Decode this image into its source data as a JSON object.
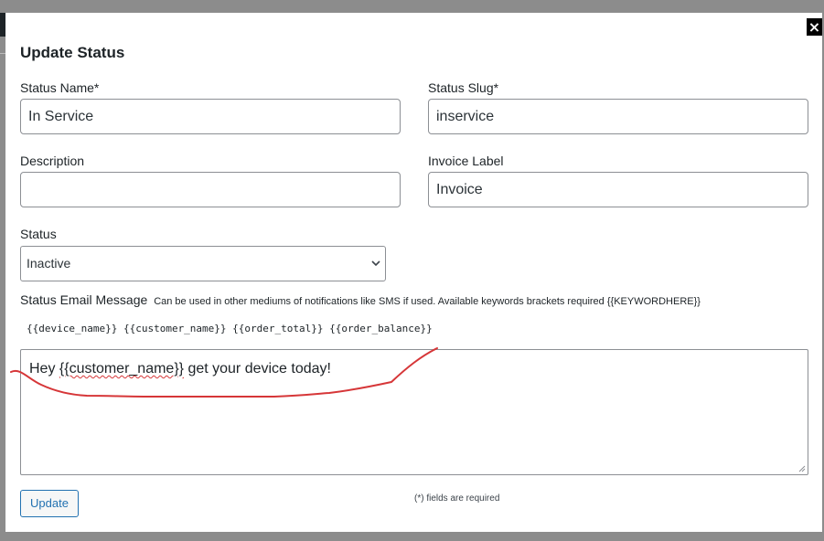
{
  "modal": {
    "title": "Update Status",
    "close_label": "×"
  },
  "form": {
    "status_name": {
      "label": "Status Name*",
      "value": "In Service"
    },
    "status_slug": {
      "label": "Status Slug*",
      "value": "inservice"
    },
    "description": {
      "label": "Description",
      "value": ""
    },
    "invoice_label": {
      "label": "Invoice Label",
      "value": "Invoice"
    },
    "status": {
      "label": "Status",
      "selected": "Inactive"
    },
    "email_message": {
      "label": "Status Email Message",
      "help": "Can be used in other mediums of notifications like SMS if used. Available keywords brackets required {{KEYWORDHERE}}",
      "keywords": "{{device_name}} {{customer_name}} {{order_total}} {{order_balance}}",
      "value_prefix": "Hey ",
      "value_keyword": "{{customer_name}}",
      "value_suffix": " get your device today!"
    },
    "submit_label": "Update",
    "required_note": "(*) fields are required"
  },
  "icons": {
    "close": "close-icon",
    "select": "chevron-down-icon",
    "resize": "resize-handle-icon"
  },
  "colors": {
    "primary": "#2271b1",
    "annotation": "#d63638"
  }
}
